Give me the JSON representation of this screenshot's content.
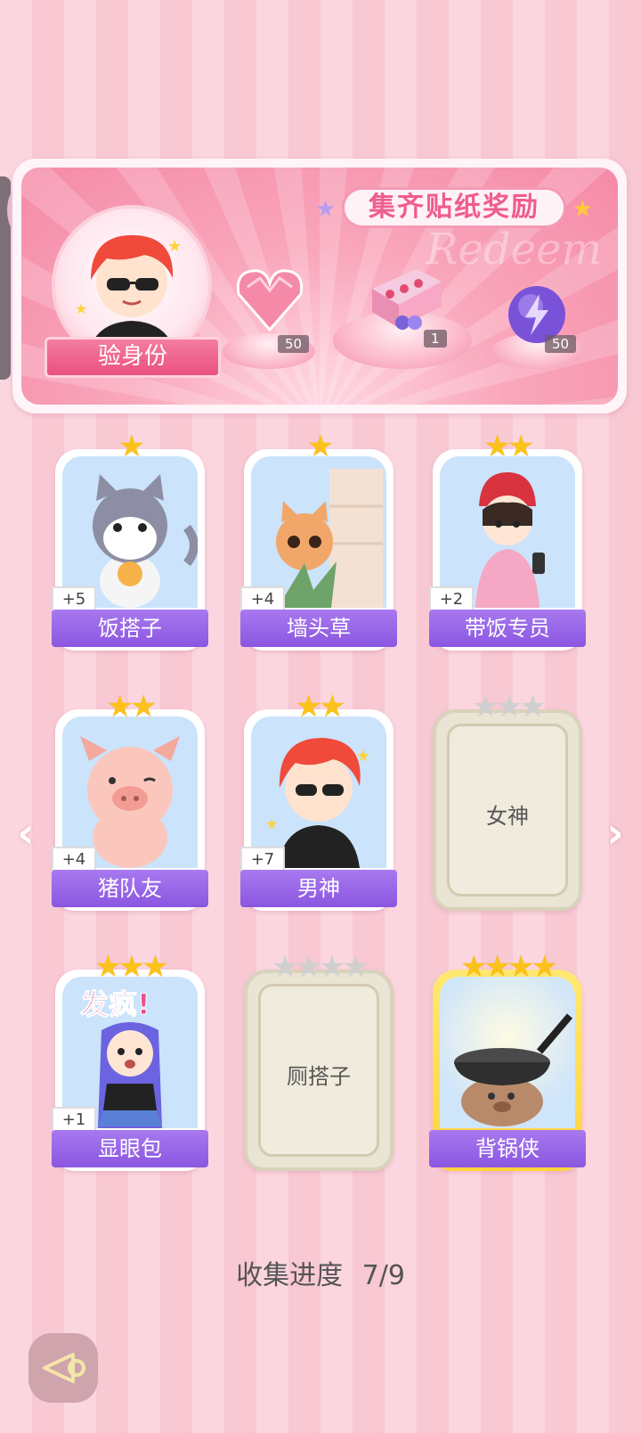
{
  "banner": {
    "title": "集齐贴纸奖励",
    "deco_text": "Redeem",
    "identity_button": "验身份",
    "rewards": [
      {
        "name": "heart-gem",
        "count": "50"
      },
      {
        "name": "gift-box",
        "count": "1"
      },
      {
        "name": "lightning-orb",
        "count": "50"
      }
    ]
  },
  "cards": [
    {
      "name": "饭搭子",
      "badge": "+5",
      "stars": 1,
      "max_stars": 1,
      "unlocked": true
    },
    {
      "name": "墙头草",
      "badge": "+4",
      "stars": 1,
      "max_stars": 1,
      "unlocked": true
    },
    {
      "name": "带饭专员",
      "badge": "+2",
      "stars": 2,
      "max_stars": 2,
      "unlocked": true
    },
    {
      "name": "猪队友",
      "badge": "+4",
      "stars": 2,
      "max_stars": 2,
      "unlocked": true
    },
    {
      "name": "男神",
      "badge": "+7",
      "stars": 2,
      "max_stars": 2,
      "unlocked": true
    },
    {
      "name": "女神",
      "badge": "",
      "stars": 0,
      "max_stars": 3,
      "unlocked": false
    },
    {
      "name": "显眼包",
      "badge": "+1",
      "stars": 3,
      "max_stars": 3,
      "unlocked": true
    },
    {
      "name": "厕搭子",
      "badge": "",
      "stars": 0,
      "max_stars": 4,
      "unlocked": false
    },
    {
      "name": "背锅侠",
      "badge": "",
      "stars": 4,
      "max_stars": 4,
      "unlocked": true
    }
  ],
  "card_art_texts": {
    "crazy_text": "发疯!"
  },
  "progress": {
    "label": "收集进度",
    "value": "7/9"
  }
}
